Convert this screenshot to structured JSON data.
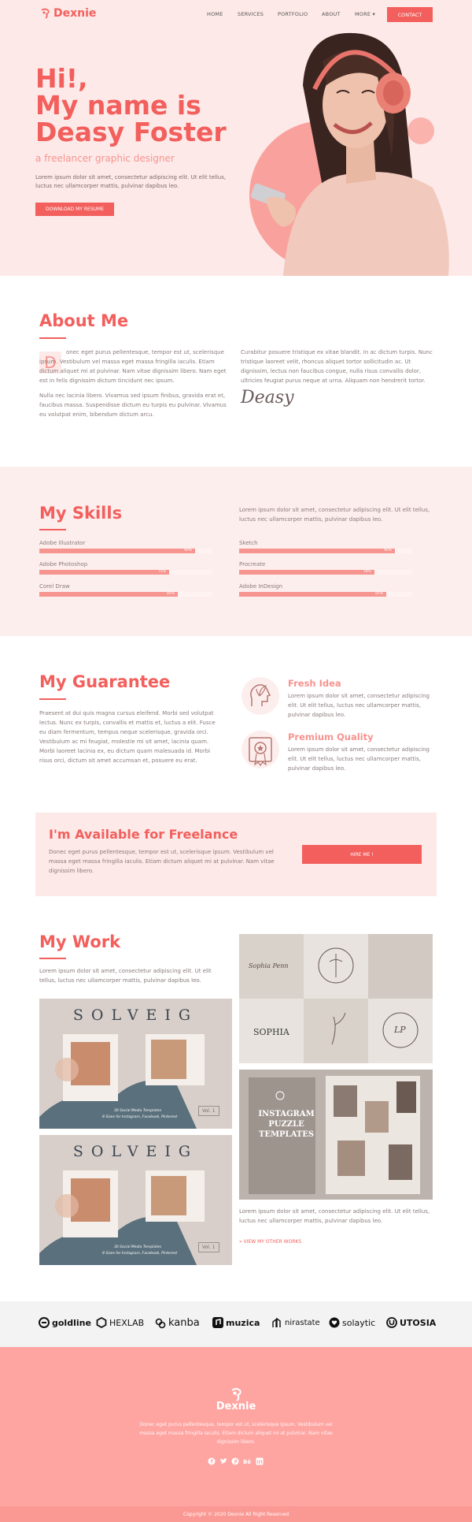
{
  "brand": {
    "name": "Dexnie"
  },
  "nav": {
    "items": [
      "HOME",
      "SERVICES",
      "PORTFOLIO",
      "ABOUT",
      "MORE"
    ],
    "contact": "CONTACT"
  },
  "hero": {
    "title_lines": [
      "Hi!,",
      "My name is",
      "Deasy Foster"
    ],
    "subtitle": "a freelancer graphic designer",
    "text": "Lorem ipsum dolor sit amet, consectetur adipiscing elit. Ut elit tellus, luctus nec ullamcorper mattis, pulvinar dapibus leo.",
    "button": "DOWNLOAD MY RESUME"
  },
  "about": {
    "title": "About Me",
    "dropcap": "D",
    "col1_p1": "onec eget purus pellentesque, tempor est ut, scelerisque ipsum. Vestibulum vel massa eget massa fringilla iaculis. Etiam dictum aliquet mi at pulvinar. Nam vitae dignissim libero. Nam eget est in felis dignissim dictum tincidunt nec ipsum.",
    "col1_p2": "Nulla nec lacinia libero. Vivamus sed ipsum finibus, gravida erat et, faucibus massa. Suspendisse dictum eu turpis eu pulvinar. Vivamus eu volutpat enim, bibendum dictum arcu.",
    "col2_p1": "Curabitur posuere tristique ex vitae blandit. In ac dictum turpis. Nunc tristique laoreet velit, rhoncus aliquet tortor sollicitudin ac. Ut dignissim, lectus non faucibus congue, nulla risus convallis dolor, ultricies feugiat purus neque at urna. Aliquam non hendrerit tortor.",
    "signature": "Deasy"
  },
  "skills": {
    "title": "My Skills",
    "intro": "Lorem ipsum dolor sit amet, consectetur adipiscing elit. Ut elit tellus, luctus nec ullamcorper mattis, pulvinar dapibus leo.",
    "items": [
      {
        "label": "Adobe Illustrator",
        "value": 0.9,
        "pct": "90%"
      },
      {
        "label": "Sketch",
        "value": 0.9,
        "pct": "90%"
      },
      {
        "label": "Adobe Photoshop",
        "value": 0.75,
        "pct": "75%"
      },
      {
        "label": "Procreate",
        "value": 0.78,
        "pct": "78%"
      },
      {
        "label": "Corel Draw",
        "value": 0.8,
        "pct": "80%"
      },
      {
        "label": "Adobe InDesign",
        "value": 0.85,
        "pct": "85%"
      }
    ]
  },
  "guarantee": {
    "title": "My Guarantee",
    "text": "Praesent at dui quis magna cursus eleifend. Morbi sed volutpat lectus. Nunc ex turpis, convallis et mattis et, luctus a elit. Fusce eu diam fermentum, tempus neque scelerisque, gravida orci. Vestibulum ac mi feugiat, molestie mi sit amet, lacinia quam. Morbi laoreet lacinia ex, eu dictum quam malesuada id. Morbi risus orci, dictum sit amet accumsan et, posuere eu erat.",
    "features": [
      {
        "title": "Fresh Idea",
        "text": "Lorem ipsum dolor sit amet, consectetur adipiscing elit. Ut elit tellus, luctus nec ullamcorper mattis, pulvinar dapibus leo."
      },
      {
        "title": "Premium Quality",
        "text": "Lorem ipsum dolor sit amet, consectetur adipiscing elit. Ut elit tellus, luctus nec ullamcorper mattis, pulvinar dapibus leo."
      }
    ]
  },
  "freelance": {
    "title": "I'm Available for Freelance",
    "text": "Donec eget purus pellentesque, tempor est ut, scelerisque ipsum. Vestibulum vel massa eget massa fringilla iaculis. Etiam dictum aliquet mi at pulvinar. Nam vitae dignissim libero.",
    "button": "HIRE ME !"
  },
  "work": {
    "title": "My Work",
    "intro": "Lorem ipsum dolor sit amet, consectetur adipiscing elit. Ut elit tellus, luctus nec ullamcorper mattis, pulvinar dapibus leo.",
    "outro": "Lorem ipsum dolor sit amet, consectetur adipiscing elit. Ut elit tellus, luctus nec ullamcorper mattis, pulvinar dapibus leo.",
    "link": "» VIEW MY OTHER WORKS",
    "solveig": {
      "name": "SOLVEIG",
      "caption1": "30 Social Media Templates",
      "caption2": "8 Sizes for Instagram, Facebook, Pinterest",
      "vol": "Vol. 1"
    },
    "puzzle": {
      "line1": "INSTAGRAM",
      "line2": "PUZZLE",
      "line3": "TEMPLATES"
    },
    "logos": [
      "Sophia Penn",
      "SOPHIA",
      "LP"
    ]
  },
  "brands": [
    "goldline",
    "HEXLAB",
    "kanba",
    "muzica",
    "nirastate",
    "solaytic",
    "UTOSIA"
  ],
  "footer": {
    "name": "Dexnie",
    "text": "Donec eget purus pellentesque, tempor est ut, scelerisque ipsum. Vestibulum vel massa eget massa fringilla iaculis. Etiam dictum aliquet mi at pulvinar. Nam vitae dignissim libero.",
    "copyright": "Copyright © 2020 Dexnie All Right Reserved"
  },
  "colors": {
    "accent": "#f25f5c",
    "soft": "#fde9e8",
    "footer": "#fea5a2"
  }
}
